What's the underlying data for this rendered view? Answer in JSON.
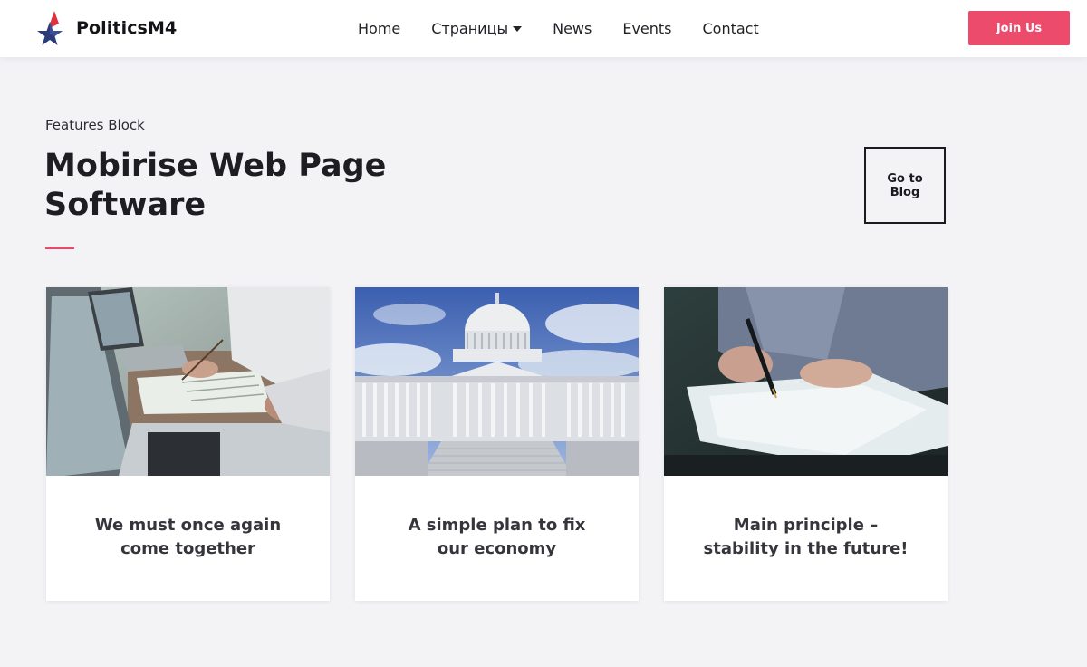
{
  "header": {
    "brand_name": "PoliticsM4",
    "nav": [
      {
        "label": "Home",
        "icon": ""
      },
      {
        "label": "Страницы",
        "icon": "caret-down-icon"
      },
      {
        "label": "News",
        "icon": ""
      },
      {
        "label": "Events",
        "icon": ""
      },
      {
        "label": "Contact",
        "icon": ""
      }
    ],
    "join_label": "Join Us",
    "logo_icon": "star-flag-logo",
    "colors": {
      "accent": "#ed4b6b",
      "logo_blue": "#2b3c7a",
      "logo_red": "#d9343f"
    }
  },
  "main": {
    "kicker": "Features Block",
    "title": "Mobirise Web Page Software",
    "blog_button": "Go to Blog",
    "cards": [
      {
        "title": "We must once again come together",
        "image": "laptop-desk-photo"
      },
      {
        "title": "A simple plan to fix our economy",
        "image": "capitol-building-photo"
      },
      {
        "title": "Main principle – stability in the future!",
        "image": "signing-document-photo"
      }
    ]
  }
}
